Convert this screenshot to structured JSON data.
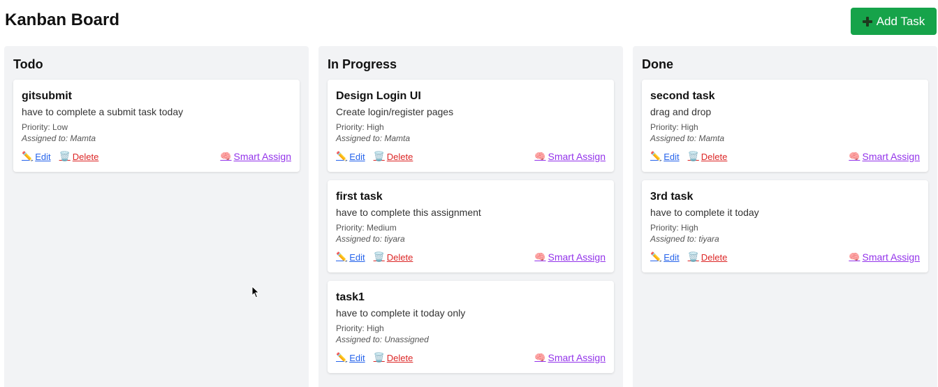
{
  "header": {
    "title": "Kanban Board",
    "add_button_label": "Add Task",
    "add_button_icon": "plus-icon",
    "accent_color": "#16a34a"
  },
  "actions": {
    "edit_label": "Edit",
    "delete_label": "Delete",
    "smart_assign_label": "Smart Assign",
    "edit_icon": "✏️",
    "delete_icon": "🗑️",
    "smart_icon": "🧠"
  },
  "columns": [
    {
      "title": "Todo",
      "cards": [
        {
          "title": "gitsubmit",
          "description": "have to complete a submit task today",
          "priority": "Priority: Low",
          "assigned": "Assigned to: Mamta"
        }
      ]
    },
    {
      "title": "In Progress",
      "cards": [
        {
          "title": "Design Login UI",
          "description": "Create login/register pages",
          "priority": "Priority: High",
          "assigned": "Assigned to: Mamta"
        },
        {
          "title": "first task",
          "description": "have to complete this assignment",
          "priority": "Priority: Medium",
          "assigned": "Assigned to: tiyara"
        },
        {
          "title": "task1",
          "description": "have to complete it today only",
          "priority": "Priority: High",
          "assigned": "Assigned to: Unassigned"
        }
      ]
    },
    {
      "title": "Done",
      "cards": [
        {
          "title": "second task",
          "description": "drag and drop",
          "priority": "Priority: High",
          "assigned": "Assigned to: Mamta"
        },
        {
          "title": "3rd task",
          "description": "have to complete it today",
          "priority": "Priority: High",
          "assigned": "Assigned to: tiyara"
        }
      ]
    }
  ]
}
